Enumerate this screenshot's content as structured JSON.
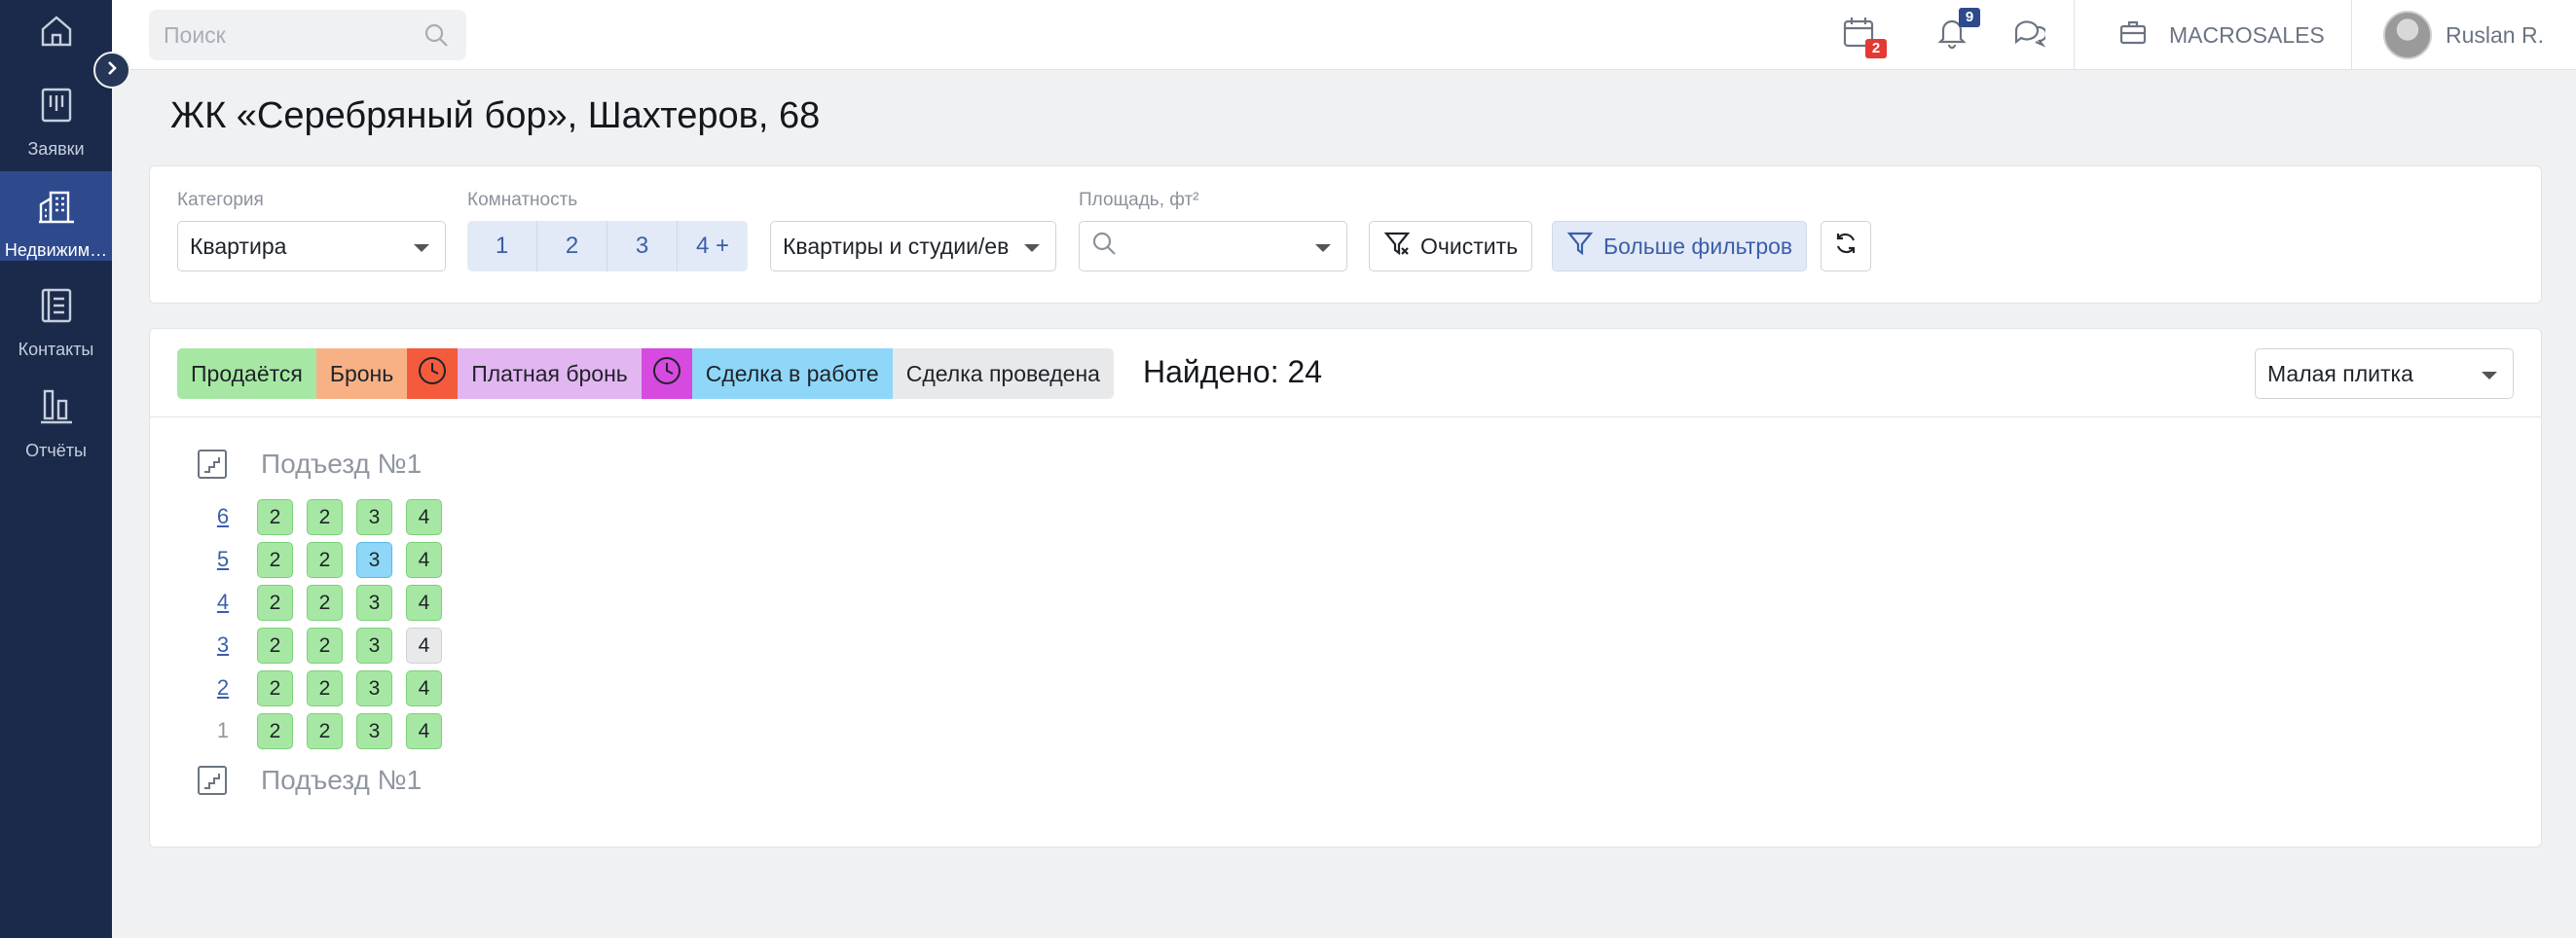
{
  "colors": {
    "sidebar_bg": "#1b2a4a",
    "sidebar_active": "#2e4a8c",
    "accent": "#3a5fa8",
    "status_selling": "#a6e8a3",
    "status_reserve": "#f8b184",
    "status_reserve_clock": "#f45b3c",
    "status_paid_reserve": "#e2b6f1",
    "status_paid_clock": "#d64ae0",
    "status_deal_in_work": "#8ed7f8",
    "status_deal_done": "#e8e9eb"
  },
  "sidebar": {
    "items": [
      {
        "label": "",
        "icon": "home-icon"
      },
      {
        "label": "Заявки",
        "icon": "requests-icon"
      },
      {
        "label": "Недвижим…",
        "icon": "building-icon",
        "active": true
      },
      {
        "label": "Контакты",
        "icon": "contacts-icon"
      },
      {
        "label": "Отчёты",
        "icon": "reports-icon"
      }
    ]
  },
  "topbar": {
    "search_placeholder": "Поиск",
    "calendar_badge": "2",
    "notifications_badge": "9",
    "company": "MACROSALES",
    "user": "Ruslan R."
  },
  "page": {
    "title": "ЖК «Серебряный бор», Шахтеров, 68"
  },
  "filters": {
    "category_label": "Категория",
    "category_value": "Квартира",
    "rooms_label": "Комнатность",
    "rooms": [
      "1",
      "2",
      "3",
      "4 +"
    ],
    "type_value": "Квартиры и студии/ев",
    "area_label": "Площадь, фт²",
    "clear_label": "Очистить",
    "more_filters_label": "Больше фильтров"
  },
  "legend": {
    "selling": "Продаётся",
    "reserve": "Бронь",
    "paid_reserve": "Платная бронь",
    "deal_in_work": "Сделка в работе",
    "deal_done": "Сделка проведена"
  },
  "found_label": "Найдено: 24",
  "view_select": "Малая плитка",
  "entrances": [
    {
      "name": "Подъезд №1",
      "floors": [
        {
          "num": "6",
          "link": true,
          "units": [
            {
              "rooms": "2",
              "status": "selling"
            },
            {
              "rooms": "2",
              "status": "selling"
            },
            {
              "rooms": "3",
              "status": "selling"
            },
            {
              "rooms": "4",
              "status": "selling"
            }
          ]
        },
        {
          "num": "5",
          "link": true,
          "units": [
            {
              "rooms": "2",
              "status": "selling"
            },
            {
              "rooms": "2",
              "status": "selling"
            },
            {
              "rooms": "3",
              "status": "deal_in_work"
            },
            {
              "rooms": "4",
              "status": "selling"
            }
          ]
        },
        {
          "num": "4",
          "link": true,
          "units": [
            {
              "rooms": "2",
              "status": "selling"
            },
            {
              "rooms": "2",
              "status": "selling"
            },
            {
              "rooms": "3",
              "status": "selling"
            },
            {
              "rooms": "4",
              "status": "selling"
            }
          ]
        },
        {
          "num": "3",
          "link": true,
          "units": [
            {
              "rooms": "2",
              "status": "selling"
            },
            {
              "rooms": "2",
              "status": "selling"
            },
            {
              "rooms": "3",
              "status": "selling"
            },
            {
              "rooms": "4",
              "status": "deal_done"
            }
          ]
        },
        {
          "num": "2",
          "link": true,
          "units": [
            {
              "rooms": "2",
              "status": "selling"
            },
            {
              "rooms": "2",
              "status": "selling"
            },
            {
              "rooms": "3",
              "status": "selling"
            },
            {
              "rooms": "4",
              "status": "selling"
            }
          ]
        },
        {
          "num": "1",
          "link": false,
          "units": [
            {
              "rooms": "2",
              "status": "selling"
            },
            {
              "rooms": "2",
              "status": "selling"
            },
            {
              "rooms": "3",
              "status": "selling"
            },
            {
              "rooms": "4",
              "status": "selling"
            }
          ]
        }
      ]
    },
    {
      "name": "Подъезд №1",
      "floors": []
    }
  ]
}
